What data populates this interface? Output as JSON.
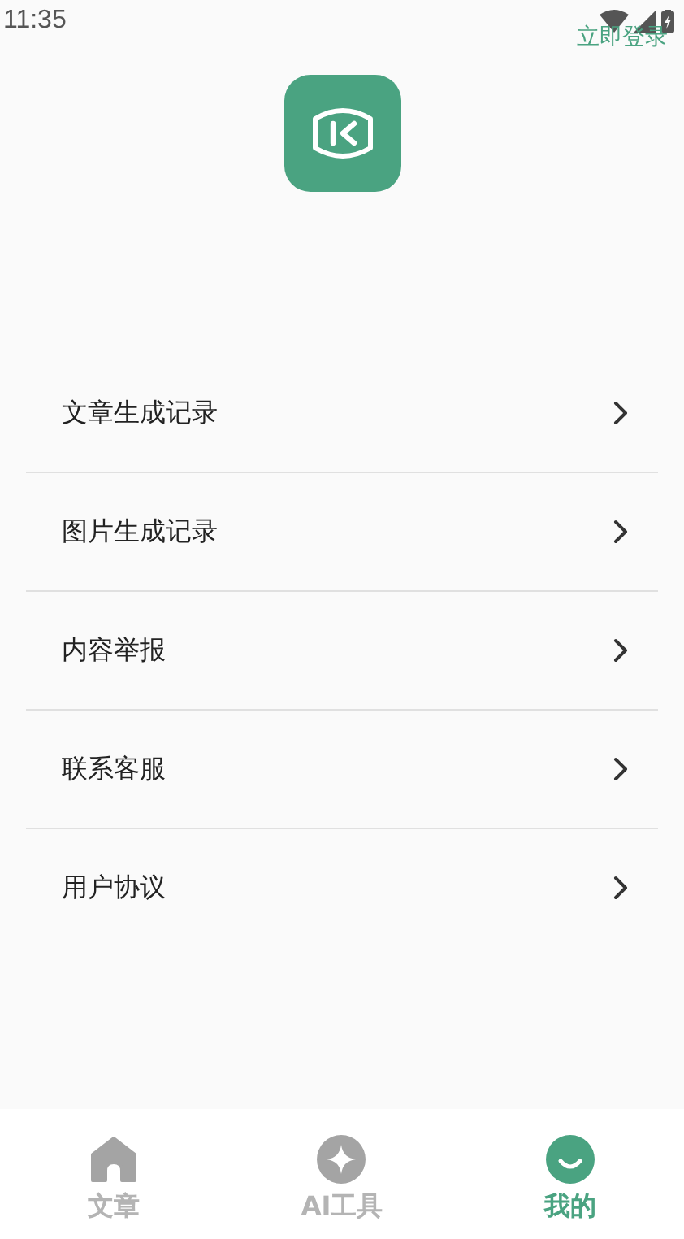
{
  "status_bar": {
    "time": "11:35"
  },
  "login_link": "立即登录",
  "menu": [
    {
      "label": "文章生成记录"
    },
    {
      "label": "图片生成记录"
    },
    {
      "label": "内容举报"
    },
    {
      "label": "联系客服"
    },
    {
      "label": "用户协议"
    }
  ],
  "tabs": [
    {
      "label": "文章",
      "kind": "home",
      "selected": false
    },
    {
      "label": "AI工具",
      "kind": "sparkle",
      "selected": false
    },
    {
      "label": "我的",
      "kind": "smile",
      "selected": true
    }
  ]
}
